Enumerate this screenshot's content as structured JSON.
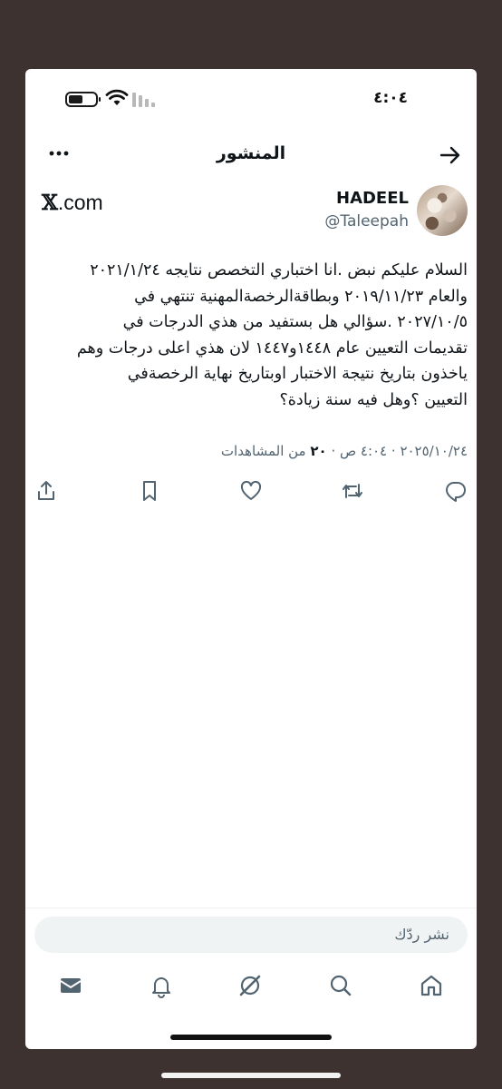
{
  "status": {
    "time": "٤:٠٤"
  },
  "header": {
    "title": "المنشور"
  },
  "author": {
    "name": "HADEEL",
    "handle": "@Taleepah"
  },
  "brand": {
    "x": "𝕏",
    "dotcom": ".com"
  },
  "tweet": {
    "text": "السلام عليكم نبض .انا اختباري التخصص نتايجه ٢٠٢١/١/٢٤\nوالعام ٢٠١٩/١١/٢٣ وبطاقةالرخصةالمهنية تنتهي في\n٢٠٢٧/١٠/٥ .سؤالي هل بستفيد من هذي الدرجات في\nتقديمات التعيين عام ١٤٤٨و١٤٤٧ لان هذي اعلى درجات وهم\nياخذون بتاريخ نتيجة الاختبار اوبتاريخ نهاية الرخصةفي\nالتعيين ؟وهل فيه سنة زيادة؟",
    "date": "٢٠٢٥/١٠/٢٤",
    "time": "٤:٠٤ ص",
    "sep": " · ",
    "views_count": "٢٠",
    "views_label": " من المشاهدات"
  },
  "reply": {
    "placeholder": "نشر ردّك"
  },
  "icons": {
    "back": "back-arrow-icon",
    "more": "more-icon",
    "reply": "reply-icon",
    "retweet": "retweet-icon",
    "like": "like-icon",
    "bookmark": "bookmark-icon",
    "share": "share-icon",
    "home": "home-icon",
    "search": "search-icon",
    "grok": "grok-icon",
    "notifications": "bell-icon",
    "messages": "mail-icon"
  },
  "colors": {
    "text": "#0f1419",
    "secondary": "#536471",
    "frame": "#3d3230"
  }
}
